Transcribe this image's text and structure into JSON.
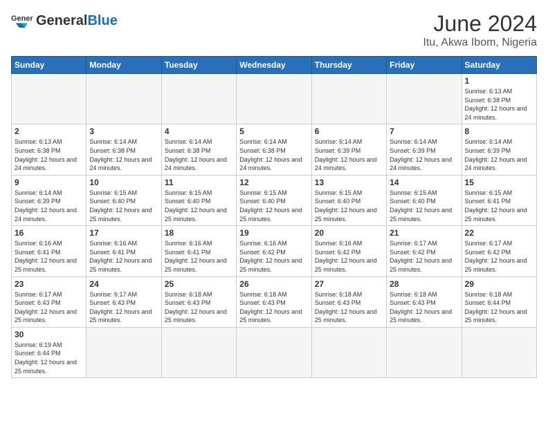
{
  "header": {
    "logo_general": "General",
    "logo_blue": "Blue",
    "title": "June 2024",
    "subtitle": "Itu, Akwa Ibom, Nigeria"
  },
  "days_of_week": [
    "Sunday",
    "Monday",
    "Tuesday",
    "Wednesday",
    "Thursday",
    "Friday",
    "Saturday"
  ],
  "weeks": [
    [
      {
        "day": "",
        "info": ""
      },
      {
        "day": "",
        "info": ""
      },
      {
        "day": "",
        "info": ""
      },
      {
        "day": "",
        "info": ""
      },
      {
        "day": "",
        "info": ""
      },
      {
        "day": "",
        "info": ""
      },
      {
        "day": "1",
        "info": "Sunrise: 6:13 AM\nSunset: 6:38 PM\nDaylight: 12 hours and 24 minutes."
      }
    ],
    [
      {
        "day": "2",
        "info": "Sunrise: 6:13 AM\nSunset: 6:38 PM\nDaylight: 12 hours and 24 minutes."
      },
      {
        "day": "3",
        "info": "Sunrise: 6:14 AM\nSunset: 6:38 PM\nDaylight: 12 hours and 24 minutes."
      },
      {
        "day": "4",
        "info": "Sunrise: 6:14 AM\nSunset: 6:38 PM\nDaylight: 12 hours and 24 minutes."
      },
      {
        "day": "5",
        "info": "Sunrise: 6:14 AM\nSunset: 6:38 PM\nDaylight: 12 hours and 24 minutes."
      },
      {
        "day": "6",
        "info": "Sunrise: 6:14 AM\nSunset: 6:39 PM\nDaylight: 12 hours and 24 minutes."
      },
      {
        "day": "7",
        "info": "Sunrise: 6:14 AM\nSunset: 6:39 PM\nDaylight: 12 hours and 24 minutes."
      },
      {
        "day": "8",
        "info": "Sunrise: 6:14 AM\nSunset: 6:39 PM\nDaylight: 12 hours and 24 minutes."
      }
    ],
    [
      {
        "day": "9",
        "info": "Sunrise: 6:14 AM\nSunset: 6:39 PM\nDaylight: 12 hours and 24 minutes."
      },
      {
        "day": "10",
        "info": "Sunrise: 6:15 AM\nSunset: 6:40 PM\nDaylight: 12 hours and 25 minutes."
      },
      {
        "day": "11",
        "info": "Sunrise: 6:15 AM\nSunset: 6:40 PM\nDaylight: 12 hours and 25 minutes."
      },
      {
        "day": "12",
        "info": "Sunrise: 6:15 AM\nSunset: 6:40 PM\nDaylight: 12 hours and 25 minutes."
      },
      {
        "day": "13",
        "info": "Sunrise: 6:15 AM\nSunset: 6:40 PM\nDaylight: 12 hours and 25 minutes."
      },
      {
        "day": "14",
        "info": "Sunrise: 6:15 AM\nSunset: 6:40 PM\nDaylight: 12 hours and 25 minutes."
      },
      {
        "day": "15",
        "info": "Sunrise: 6:15 AM\nSunset: 6:41 PM\nDaylight: 12 hours and 25 minutes."
      }
    ],
    [
      {
        "day": "16",
        "info": "Sunrise: 6:16 AM\nSunset: 6:41 PM\nDaylight: 12 hours and 25 minutes."
      },
      {
        "day": "17",
        "info": "Sunrise: 6:16 AM\nSunset: 6:41 PM\nDaylight: 12 hours and 25 minutes."
      },
      {
        "day": "18",
        "info": "Sunrise: 6:16 AM\nSunset: 6:41 PM\nDaylight: 12 hours and 25 minutes."
      },
      {
        "day": "19",
        "info": "Sunrise: 6:16 AM\nSunset: 6:42 PM\nDaylight: 12 hours and 25 minutes."
      },
      {
        "day": "20",
        "info": "Sunrise: 6:16 AM\nSunset: 6:42 PM\nDaylight: 12 hours and 25 minutes."
      },
      {
        "day": "21",
        "info": "Sunrise: 6:17 AM\nSunset: 6:42 PM\nDaylight: 12 hours and 25 minutes."
      },
      {
        "day": "22",
        "info": "Sunrise: 6:17 AM\nSunset: 6:42 PM\nDaylight: 12 hours and 25 minutes."
      }
    ],
    [
      {
        "day": "23",
        "info": "Sunrise: 6:17 AM\nSunset: 6:43 PM\nDaylight: 12 hours and 25 minutes."
      },
      {
        "day": "24",
        "info": "Sunrise: 6:17 AM\nSunset: 6:43 PM\nDaylight: 12 hours and 25 minutes."
      },
      {
        "day": "25",
        "info": "Sunrise: 6:18 AM\nSunset: 6:43 PM\nDaylight: 12 hours and 25 minutes."
      },
      {
        "day": "26",
        "info": "Sunrise: 6:18 AM\nSunset: 6:43 PM\nDaylight: 12 hours and 25 minutes."
      },
      {
        "day": "27",
        "info": "Sunrise: 6:18 AM\nSunset: 6:43 PM\nDaylight: 12 hours and 25 minutes."
      },
      {
        "day": "28",
        "info": "Sunrise: 6:18 AM\nSunset: 6:43 PM\nDaylight: 12 hours and 25 minutes."
      },
      {
        "day": "29",
        "info": "Sunrise: 6:18 AM\nSunset: 6:44 PM\nDaylight: 12 hours and 25 minutes."
      }
    ],
    [
      {
        "day": "30",
        "info": "Sunrise: 6:19 AM\nSunset: 6:44 PM\nDaylight: 12 hours and 25 minutes."
      },
      {
        "day": "",
        "info": ""
      },
      {
        "day": "",
        "info": ""
      },
      {
        "day": "",
        "info": ""
      },
      {
        "day": "",
        "info": ""
      },
      {
        "day": "",
        "info": ""
      },
      {
        "day": "",
        "info": ""
      }
    ]
  ]
}
